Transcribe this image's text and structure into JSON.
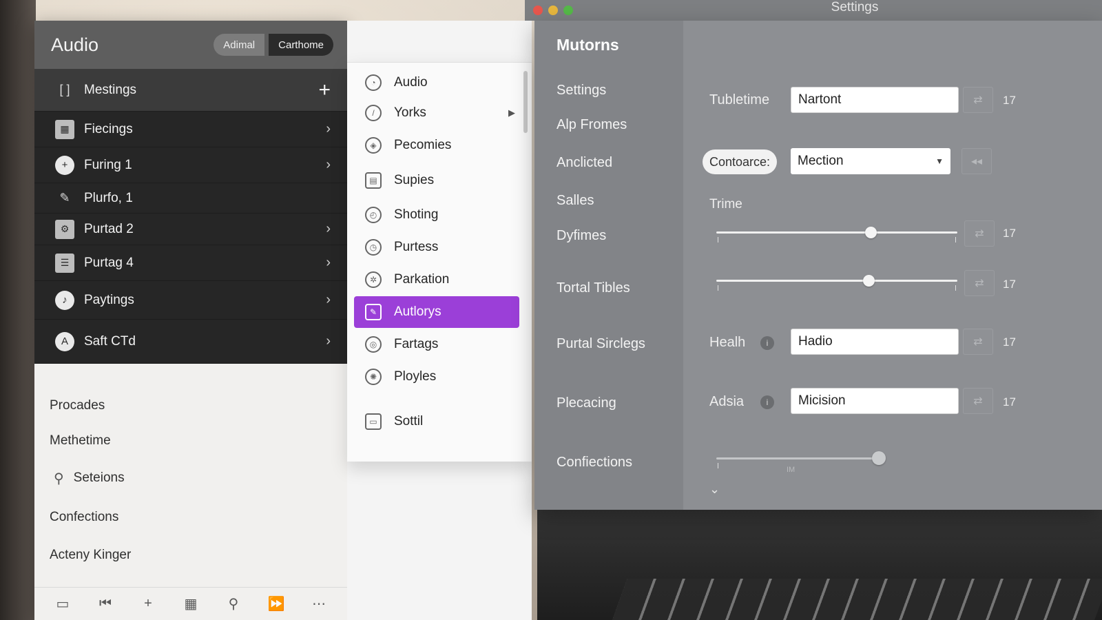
{
  "left_panel": {
    "title": "Audio",
    "segments": [
      "Adimal",
      "Carthome"
    ],
    "top_row": {
      "label": "Mestings",
      "icon": "bracket-icon",
      "action_icon": "plus-icon"
    },
    "rows": [
      {
        "label": "Fiecings",
        "icon": "grid-icon"
      },
      {
        "label": "Furing 1",
        "icon": "plus-circle-icon"
      },
      {
        "label": "Plurfo, 1",
        "icon": "pen-icon"
      },
      {
        "label": "Purtad 2",
        "icon": "gear-icon"
      },
      {
        "label": "Purtag 4",
        "icon": "list-icon"
      },
      {
        "label": "Paytings",
        "icon": "music-icon"
      },
      {
        "label": "Saft CTd",
        "icon": "letter-a-icon"
      }
    ],
    "light_items": [
      "Procades",
      "Methetime",
      "Seteions",
      "Confections",
      "Acteny Kinger"
    ],
    "toolbar_icons": [
      "monitor-icon",
      "skip-back-icon",
      "plus-icon",
      "grid-icon",
      "microphone-icon",
      "fast-forward-icon",
      "more-icon"
    ]
  },
  "menu": {
    "items": [
      {
        "label": "Audio",
        "icon": "audio-icon"
      },
      {
        "label": "Yorks",
        "icon": "clock-icon",
        "has_submenu": true
      },
      {
        "label": "Pecomies",
        "icon": "shield-icon"
      },
      {
        "label": "Supies",
        "icon": "save-icon"
      },
      {
        "label": "Shoting",
        "icon": "pie-icon"
      },
      {
        "label": "Purtess",
        "icon": "timer-icon"
      },
      {
        "label": "Parkation",
        "icon": "aperture-icon"
      },
      {
        "label": "Autlorys",
        "icon": "edit-icon",
        "selected": true
      },
      {
        "label": "Fartags",
        "icon": "tag-icon"
      },
      {
        "label": "Ployles",
        "icon": "globe-icon"
      },
      {
        "label": "Sottil",
        "icon": "window-icon"
      }
    ],
    "selected_color": "#9b3fd8"
  },
  "settings": {
    "window_title": "Settings",
    "sidebar_title": "Mutorns",
    "sidebar_items": [
      "Settings",
      "Alp Fromes",
      "Anclicted",
      "Salles",
      "Dyfimes",
      "Tortal Tibles",
      "Purtal Sirclegs",
      "Plecacing",
      "Confiections"
    ],
    "field_tubletime": {
      "label": "Tubletime",
      "value": "Nartont",
      "count": "17"
    },
    "field_contoarce": {
      "pill": "Contoarce:",
      "value": "Mection"
    },
    "trime_label": "Trime",
    "slider_1": {
      "level": 0.64,
      "count": "17"
    },
    "slider_2": {
      "level": 0.63,
      "count": "17"
    },
    "field_health": {
      "label": "Healh",
      "value": "Hadio",
      "count": "17"
    },
    "field_adsia": {
      "label": "Adsia",
      "value": "Micision",
      "count": "17"
    },
    "slider_3": {
      "level": 1.0,
      "caption": "IM"
    }
  }
}
